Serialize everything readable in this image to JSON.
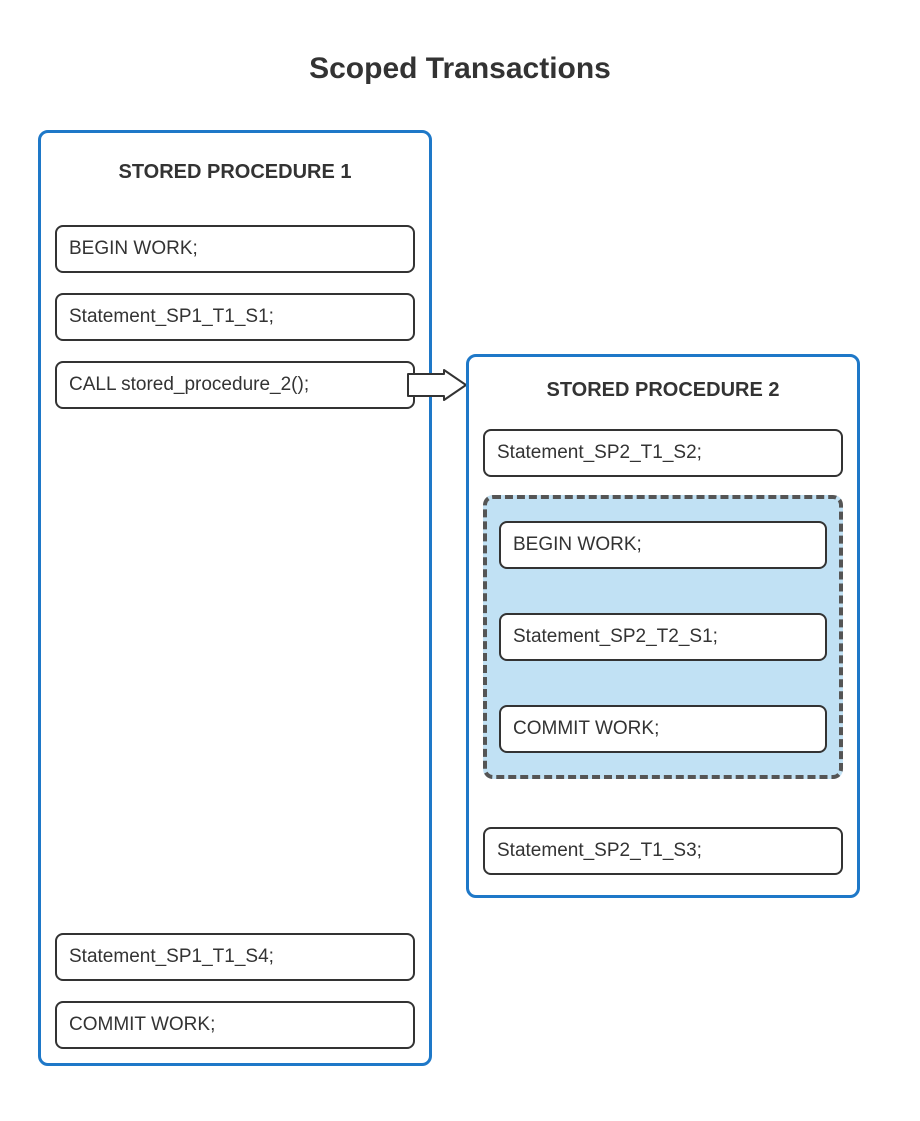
{
  "title": "Scoped Transactions",
  "procedure1": {
    "heading": "STORED PROCEDURE 1",
    "statements": {
      "s1": "BEGIN WORK;",
      "s2": "Statement_SP1_T1_S1;",
      "s3": "CALL stored_procedure_2();",
      "s4": "Statement_SP1_T1_S4;",
      "s5": "COMMIT WORK;"
    }
  },
  "procedure2": {
    "heading": "STORED PROCEDURE 2",
    "statements": {
      "s1": "Statement_SP2_T1_S2;",
      "s2": "BEGIN WORK;",
      "s3": "Statement_SP2_T2_S1;",
      "s4": "COMMIT WORK;",
      "s5": "Statement_SP2_T1_S3;"
    }
  },
  "colors": {
    "border_blue": "#1E78C8",
    "highlight_fill": "#C1E1F4",
    "dash_border": "#555555"
  }
}
